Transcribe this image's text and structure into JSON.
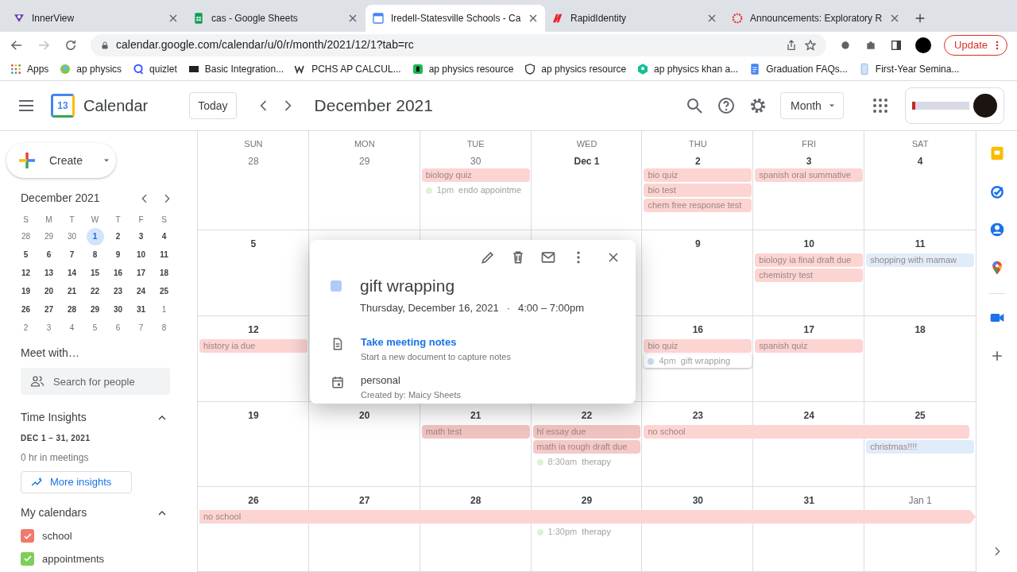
{
  "browser": {
    "tabs": [
      {
        "title": "InnerView",
        "selected": false
      },
      {
        "title": "cas - Google Sheets",
        "selected": false
      },
      {
        "title": "Iredell-Statesville Schools - Ca",
        "selected": true
      },
      {
        "title": "RapidIdentity",
        "selected": false
      },
      {
        "title": "Announcements: Exploratory R",
        "selected": false
      }
    ],
    "url": "calendar.google.com/calendar/u/0/r/month/2021/12/1?tab=rc",
    "update_button": "Update",
    "bookmarks": [
      "Apps",
      "ap physics",
      "quizlet",
      "Basic Integration...",
      "PCHS AP CALCUL...",
      "ap physics resource",
      "ap physics resource",
      "ap physics khan a...",
      "Graduation FAQs...",
      "First-Year Semina..."
    ]
  },
  "header": {
    "logo_day": "13",
    "app_name": "Calendar",
    "today_button": "Today",
    "period": "December 2021",
    "view": "Month"
  },
  "sidebar": {
    "create": "Create",
    "mini_calendar": {
      "title": "December 2021",
      "weekdays": [
        "S",
        "M",
        "T",
        "W",
        "T",
        "F",
        "S"
      ],
      "days": [
        {
          "label": "28",
          "other_month": true,
          "selected": false
        },
        {
          "label": "29",
          "other_month": true,
          "selected": false
        },
        {
          "label": "30",
          "other_month": true,
          "selected": false
        },
        {
          "label": "1",
          "other_month": false,
          "selected": true
        },
        {
          "label": "2",
          "other_month": false,
          "selected": false
        },
        {
          "label": "3",
          "other_month": false,
          "selected": false
        },
        {
          "label": "4",
          "other_month": false,
          "selected": false
        },
        {
          "label": "5",
          "other_month": false,
          "selected": false
        },
        {
          "label": "6",
          "other_month": false,
          "selected": false
        },
        {
          "label": "7",
          "other_month": false,
          "selected": false
        },
        {
          "label": "8",
          "other_month": false,
          "selected": false
        },
        {
          "label": "9",
          "other_month": false,
          "selected": false
        },
        {
          "label": "10",
          "other_month": false,
          "selected": false
        },
        {
          "label": "11",
          "other_month": false,
          "selected": false
        },
        {
          "label": "12",
          "other_month": false,
          "selected": false
        },
        {
          "label": "13",
          "other_month": false,
          "selected": false
        },
        {
          "label": "14",
          "other_month": false,
          "selected": false
        },
        {
          "label": "15",
          "other_month": false,
          "selected": false
        },
        {
          "label": "16",
          "other_month": false,
          "selected": false
        },
        {
          "label": "17",
          "other_month": false,
          "selected": false
        },
        {
          "label": "18",
          "other_month": false,
          "selected": false
        },
        {
          "label": "19",
          "other_month": false,
          "selected": false
        },
        {
          "label": "20",
          "other_month": false,
          "selected": false
        },
        {
          "label": "21",
          "other_month": false,
          "selected": false
        },
        {
          "label": "22",
          "other_month": false,
          "selected": false
        },
        {
          "label": "23",
          "other_month": false,
          "selected": false
        },
        {
          "label": "24",
          "other_month": false,
          "selected": false
        },
        {
          "label": "25",
          "other_month": false,
          "selected": false
        },
        {
          "label": "26",
          "other_month": false,
          "selected": false
        },
        {
          "label": "27",
          "other_month": false,
          "selected": false
        },
        {
          "label": "28",
          "other_month": false,
          "selected": false
        },
        {
          "label": "29",
          "other_month": false,
          "selected": false
        },
        {
          "label": "30",
          "other_month": false,
          "selected": false
        },
        {
          "label": "31",
          "other_month": false,
          "selected": false
        },
        {
          "label": "1",
          "other_month": true,
          "selected": false
        },
        {
          "label": "2",
          "other_month": true,
          "selected": false
        },
        {
          "label": "3",
          "other_month": true,
          "selected": false
        },
        {
          "label": "4",
          "other_month": true,
          "selected": false
        },
        {
          "label": "5",
          "other_month": true,
          "selected": false
        },
        {
          "label": "6",
          "other_month": true,
          "selected": false
        },
        {
          "label": "7",
          "other_month": true,
          "selected": false
        },
        {
          "label": "8",
          "other_month": true,
          "selected": false
        }
      ]
    },
    "meet_with": {
      "title": "Meet with…",
      "placeholder": "Search for people"
    },
    "time_insights": {
      "title": "Time Insights",
      "expanded": true,
      "range": "DEC 1 – 31, 2021",
      "meetings": "0 hr in meetings",
      "button": "More insights"
    },
    "my_calendars": {
      "title": "My calendars",
      "expanded": true,
      "items": [
        {
          "label": "school",
          "checked": true,
          "color": "#f07a6c"
        },
        {
          "label": "appointments",
          "checked": true,
          "color": "#7ccf57"
        }
      ]
    }
  },
  "calendar": {
    "weekdays": [
      "SUN",
      "MON",
      "TUE",
      "WED",
      "THU",
      "FRI",
      "SAT"
    ],
    "weeks": [
      {
        "days": [
          {
            "kind": "day",
            "label": "28",
            "other_month": true
          },
          {
            "kind": "day",
            "label": "29",
            "other_month": true
          },
          {
            "kind": "day",
            "label": "30",
            "other_month": true,
            "events": [
              {
                "kind": "chip",
                "title": "biology quiz",
                "color": "#fcd4d2",
                "selected": false
              },
              {
                "kind": "timed",
                "time": "1pm",
                "title": "endo appointme",
                "color": "#dcf3d4",
                "selected": false
              }
            ]
          },
          {
            "kind": "day",
            "label": "Dec 1",
            "other_month": false
          },
          {
            "kind": "day",
            "label": "2",
            "other_month": false,
            "events": [
              {
                "kind": "chip",
                "title": "bio quiz",
                "color": "#fcd4d2",
                "selected": false
              },
              {
                "kind": "chip",
                "title": "bio test",
                "color": "#fcd4d2",
                "selected": false
              },
              {
                "kind": "chip",
                "title": "chem free response test",
                "color": "#fcd4d2",
                "selected": false
              }
            ]
          },
          {
            "kind": "day",
            "label": "3",
            "other_month": false,
            "events": [
              {
                "kind": "chip",
                "title": "spanish oral summative",
                "color": "#fcd4d2",
                "selected": false
              }
            ]
          },
          {
            "kind": "day",
            "label": "4",
            "other_month": false
          }
        ]
      },
      {
        "days": [
          {
            "kind": "day",
            "label": "5",
            "other_month": false
          },
          {
            "kind": "covered"
          },
          {
            "kind": "covered"
          },
          {
            "kind": "covered"
          },
          {
            "kind": "day",
            "label": "9",
            "other_month": false
          },
          {
            "kind": "day",
            "label": "10",
            "other_month": false,
            "events": [
              {
                "kind": "chip",
                "title": "biology ia final draft due",
                "color": "#fcd4d2",
                "selected": false
              },
              {
                "kind": "chip",
                "title": "chemistry test",
                "color": "#fcd4d2",
                "selected": false
              }
            ]
          },
          {
            "kind": "day",
            "label": "11",
            "other_month": false,
            "events": [
              {
                "kind": "chip",
                "title": "shopping with mamaw",
                "color": "#e1ecfa",
                "selected": false
              }
            ]
          }
        ]
      },
      {
        "days": [
          {
            "kind": "day",
            "label": "12",
            "other_month": false,
            "events": [
              {
                "kind": "chip",
                "title": "history ia due",
                "color": "#fcd4d2",
                "selected": false
              }
            ]
          },
          {
            "kind": "covered"
          },
          {
            "kind": "covered"
          },
          {
            "kind": "covered"
          },
          {
            "kind": "day",
            "label": "16",
            "other_month": false,
            "events": [
              {
                "kind": "chip",
                "title": "bio quiz",
                "color": "#fcd4d2",
                "selected": false
              },
              {
                "kind": "timed",
                "time": "4pm",
                "title": "gift wrapping",
                "color": "#c9dbf5",
                "selected": true
              }
            ]
          },
          {
            "kind": "day",
            "label": "17",
            "other_month": false,
            "events": [
              {
                "kind": "chip",
                "title": "spanish quiz",
                "color": "#fcd4d2",
                "selected": false
              }
            ]
          },
          {
            "kind": "day",
            "label": "18",
            "other_month": false
          }
        ]
      },
      {
        "days": [
          {
            "kind": "day",
            "label": "19",
            "other_month": false
          },
          {
            "kind": "day",
            "label": "20",
            "other_month": false
          },
          {
            "kind": "day",
            "label": "21",
            "other_month": false,
            "events": [
              {
                "kind": "chip",
                "title": "math test",
                "color": "#f0c3c1",
                "selected": false
              }
            ]
          },
          {
            "kind": "day",
            "label": "22",
            "other_month": false,
            "events": [
              {
                "kind": "chip",
                "title": "hl essay due",
                "color": "#f0c3c1",
                "selected": false
              },
              {
                "kind": "chip",
                "title": "math ia rough draft due",
                "color": "#f5c9c7",
                "selected": false
              },
              {
                "kind": "timed",
                "time": "8:30am",
                "title": "therapy",
                "color": "#dcf3d4",
                "selected": false
              }
            ]
          },
          {
            "kind": "day",
            "label": "23",
            "other_month": false,
            "events": [
              {
                "kind": "through-week",
                "title": "no school",
                "color": "#fcd4d2",
                "continues": false,
                "selected": false
              }
            ]
          },
          {
            "kind": "day",
            "label": "24",
            "other_month": false
          },
          {
            "kind": "day",
            "label": "25",
            "other_month": false,
            "events": [
              {
                "kind": "chip",
                "title": "christmas!!!!",
                "color": "#e1ecfa",
                "selected": false
              }
            ]
          }
        ]
      },
      {
        "days": [
          {
            "kind": "day",
            "label": "26",
            "other_month": false,
            "events": [
              {
                "kind": "through-week",
                "title": "no school",
                "color": "#fcd4d2",
                "continues": true,
                "selected": false
              }
            ]
          },
          {
            "kind": "day",
            "label": "27",
            "other_month": false
          },
          {
            "kind": "day",
            "label": "28",
            "other_month": false
          },
          {
            "kind": "day",
            "label": "29",
            "other_month": false,
            "events": [
              {
                "kind": "timed",
                "time": "1:30pm",
                "title": "therapy",
                "color": "#dcf3d4",
                "selected": false
              }
            ]
          },
          {
            "kind": "day",
            "label": "30",
            "other_month": false
          },
          {
            "kind": "day",
            "label": "31",
            "other_month": false
          },
          {
            "kind": "day",
            "label": "Jan 1",
            "other_month": true
          }
        ]
      }
    ]
  },
  "popup": {
    "title": "gift wrapping",
    "color": "#aecbfa",
    "date": "Thursday, December 16, 2021",
    "separator": "·",
    "time": "4:00 – 7:00pm",
    "notes_link": "Take meeting notes",
    "notes_hint": "Start a new document to capture notes",
    "calendar": "personal",
    "creator": "Created by: Maicy Sheets"
  }
}
